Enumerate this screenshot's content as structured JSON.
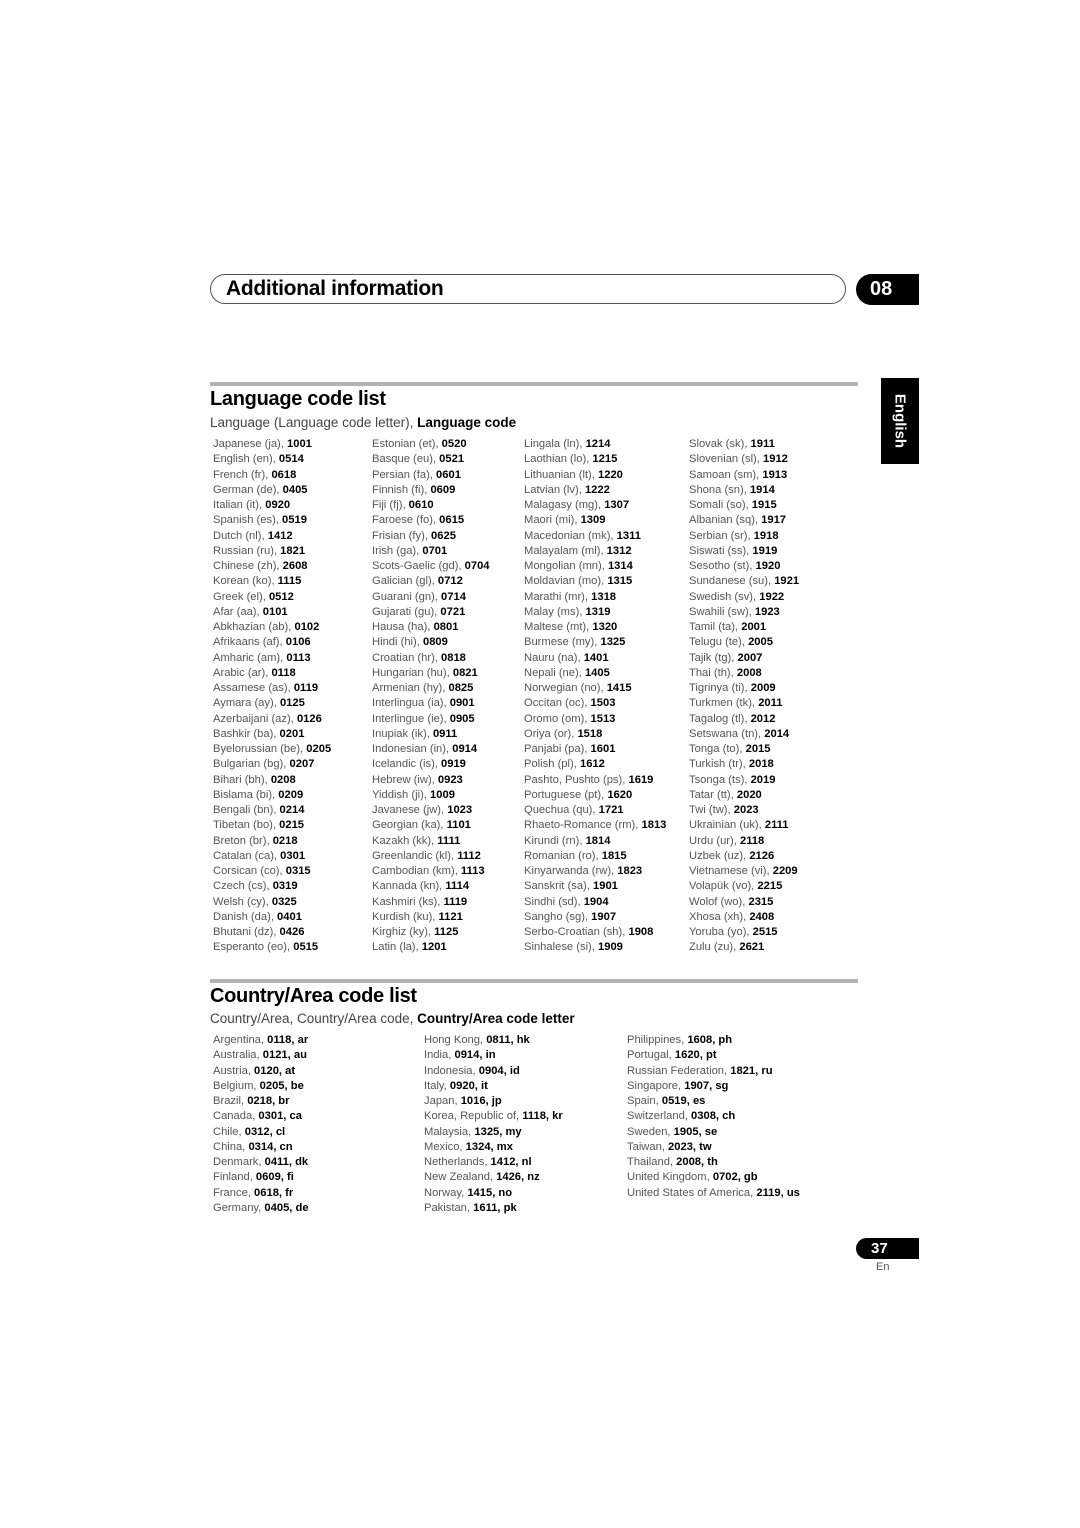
{
  "header": {
    "title": "Additional information",
    "chapter": "08",
    "language_tab": "English"
  },
  "language_section": {
    "title": "Language code list",
    "subtitle_plain": "Language (Language code letter), ",
    "subtitle_bold": "Language code",
    "columns": [
      [
        {
          "name": "Japanese (ja), ",
          "code": "1001"
        },
        {
          "name": "English (en), ",
          "code": "0514"
        },
        {
          "name": "French (fr), ",
          "code": "0618"
        },
        {
          "name": "German (de), ",
          "code": "0405"
        },
        {
          "name": "Italian (it), ",
          "code": "0920"
        },
        {
          "name": "Spanish (es), ",
          "code": "0519"
        },
        {
          "name": "Dutch (nl), ",
          "code": "1412"
        },
        {
          "name": "Russian (ru), ",
          "code": "1821"
        },
        {
          "name": "Chinese (zh), ",
          "code": "2608"
        },
        {
          "name": "Korean (ko), ",
          "code": "1115"
        },
        {
          "name": "Greek (el), ",
          "code": "0512"
        },
        {
          "name": "Afar (aa), ",
          "code": "0101"
        },
        {
          "name": "Abkhazian (ab), ",
          "code": "0102"
        },
        {
          "name": "Afrikaans (af), ",
          "code": "0106"
        },
        {
          "name": "Amharic (am), ",
          "code": "0113"
        },
        {
          "name": "Arabic (ar), ",
          "code": "0118"
        },
        {
          "name": "Assamese (as), ",
          "code": "0119"
        },
        {
          "name": "Aymara (ay), ",
          "code": "0125"
        },
        {
          "name": "Azerbaijani (az), ",
          "code": "0126"
        },
        {
          "name": "Bashkir (ba), ",
          "code": "0201"
        },
        {
          "name": "Byelorussian (be), ",
          "code": "0205"
        },
        {
          "name": "Bulgarian (bg), ",
          "code": "0207"
        },
        {
          "name": "Bihari (bh), ",
          "code": "0208"
        },
        {
          "name": "Bislama (bi), ",
          "code": "0209"
        },
        {
          "name": "Bengali (bn), ",
          "code": "0214"
        },
        {
          "name": "Tibetan (bo), ",
          "code": "0215"
        },
        {
          "name": "Breton (br), ",
          "code": "0218"
        },
        {
          "name": "Catalan (ca), ",
          "code": "0301"
        },
        {
          "name": "Corsican (co), ",
          "code": "0315"
        },
        {
          "name": "Czech (cs), ",
          "code": "0319"
        },
        {
          "name": "Welsh (cy), ",
          "code": "0325"
        },
        {
          "name": "Danish (da), ",
          "code": "0401"
        },
        {
          "name": "Bhutani (dz), ",
          "code": "0426"
        },
        {
          "name": "Esperanto (eo), ",
          "code": "0515"
        }
      ],
      [
        {
          "name": "Estonian (et), ",
          "code": "0520"
        },
        {
          "name": "Basque (eu), ",
          "code": "0521"
        },
        {
          "name": "Persian (fa), ",
          "code": "0601"
        },
        {
          "name": "Finnish (fi), ",
          "code": "0609"
        },
        {
          "name": "Fiji (fj), ",
          "code": "0610"
        },
        {
          "name": "Faroese (fo), ",
          "code": "0615"
        },
        {
          "name": "Frisian (fy), ",
          "code": "0625"
        },
        {
          "name": "Irish (ga), ",
          "code": "0701"
        },
        {
          "name": "Scots-Gaelic (gd), ",
          "code": "0704"
        },
        {
          "name": "Galician (gl), ",
          "code": "0712"
        },
        {
          "name": "Guarani (gn), ",
          "code": "0714"
        },
        {
          "name": "Gujarati (gu), ",
          "code": "0721"
        },
        {
          "name": "Hausa (ha), ",
          "code": "0801"
        },
        {
          "name": "Hindi (hi), ",
          "code": "0809"
        },
        {
          "name": "Croatian (hr), ",
          "code": "0818"
        },
        {
          "name": "Hungarian (hu), ",
          "code": "0821"
        },
        {
          "name": "Armenian (hy), ",
          "code": "0825"
        },
        {
          "name": "Interlingua (ia), ",
          "code": "0901"
        },
        {
          "name": "Interlingue (ie), ",
          "code": "0905"
        },
        {
          "name": "Inupiak (ik), ",
          "code": "0911"
        },
        {
          "name": "Indonesian (in), ",
          "code": "0914"
        },
        {
          "name": "Icelandic (is), ",
          "code": "0919"
        },
        {
          "name": "Hebrew (iw), ",
          "code": "0923"
        },
        {
          "name": "Yiddish (ji), ",
          "code": "1009"
        },
        {
          "name": "Javanese (jw), ",
          "code": "1023"
        },
        {
          "name": "Georgian (ka), ",
          "code": "1101"
        },
        {
          "name": "Kazakh (kk), ",
          "code": "1111"
        },
        {
          "name": "Greenlandic  (kl), ",
          "code": "1112"
        },
        {
          "name": "Cambodian (km), ",
          "code": "1113"
        },
        {
          "name": "Kannada (kn), ",
          "code": "1114"
        },
        {
          "name": "Kashmiri (ks), ",
          "code": "1119"
        },
        {
          "name": "Kurdish (ku), ",
          "code": "1121"
        },
        {
          "name": "Kirghiz (ky), ",
          "code": "1125"
        },
        {
          "name": "Latin (la), ",
          "code": "1201"
        }
      ],
      [
        {
          "name": "Lingala (ln), ",
          "code": "1214"
        },
        {
          "name": "Laothian (lo), ",
          "code": "1215"
        },
        {
          "name": "Lithuanian (lt), ",
          "code": "1220"
        },
        {
          "name": "Latvian (lv), ",
          "code": "1222"
        },
        {
          "name": "Malagasy (mg), ",
          "code": "1307"
        },
        {
          "name": "Maori (mi), ",
          "code": "1309"
        },
        {
          "name": "Macedonian (mk), ",
          "code": "1311"
        },
        {
          "name": "Malayalam  (ml), ",
          "code": "1312"
        },
        {
          "name": "Mongolian (mn), ",
          "code": "1314"
        },
        {
          "name": "Moldavian (mo), ",
          "code": "1315"
        },
        {
          "name": "Marathi (mr), ",
          "code": "1318"
        },
        {
          "name": "Malay  (ms), ",
          "code": "1319"
        },
        {
          "name": "Maltese (mt), ",
          "code": "1320"
        },
        {
          "name": "Burmese (my), ",
          "code": "1325"
        },
        {
          "name": "Nauru (na), ",
          "code": "1401"
        },
        {
          "name": "Nepali (ne), ",
          "code": "1405"
        },
        {
          "name": "Norwegian (no), ",
          "code": "1415"
        },
        {
          "name": "Occitan (oc), ",
          "code": "1503"
        },
        {
          "name": "Oromo (om), ",
          "code": "1513"
        },
        {
          "name": "Oriya (or), ",
          "code": "1518"
        },
        {
          "name": "Panjabi (pa), ",
          "code": "1601"
        },
        {
          "name": "Polish (pl), ",
          "code": "1612"
        },
        {
          "name": "Pashto, Pushto (ps), ",
          "code": "1619"
        },
        {
          "name": "Portuguese (pt), ",
          "code": "1620"
        },
        {
          "name": "Quechua (qu), ",
          "code": "1721"
        },
        {
          "name": "Rhaeto-Romance (rm), ",
          "code": "1813"
        },
        {
          "name": "Kirundi (rn), ",
          "code": "1814"
        },
        {
          "name": "Romanian (ro), ",
          "code": "1815"
        },
        {
          "name": "Kinyarwanda (rw), ",
          "code": "1823"
        },
        {
          "name": "Sanskrit (sa), ",
          "code": "1901"
        },
        {
          "name": "Sindhi (sd), ",
          "code": "1904"
        },
        {
          "name": "Sangho (sg), ",
          "code": "1907"
        },
        {
          "name": "Serbo-Croatian (sh), ",
          "code": "1908"
        },
        {
          "name": "Sinhalese (si), ",
          "code": "1909"
        }
      ],
      [
        {
          "name": "Slovak (sk), ",
          "code": "1911"
        },
        {
          "name": "Slovenian (sl), ",
          "code": "1912"
        },
        {
          "name": "Samoan (sm), ",
          "code": "1913"
        },
        {
          "name": "Shona (sn), ",
          "code": "1914"
        },
        {
          "name": "Somali (so), ",
          "code": "1915"
        },
        {
          "name": "Albanian (sq), ",
          "code": "1917"
        },
        {
          "name": "Serbian (sr), ",
          "code": "1918"
        },
        {
          "name": "Siswati (ss), ",
          "code": "1919"
        },
        {
          "name": "Sesotho (st), ",
          "code": "1920"
        },
        {
          "name": "Sundanese (su), ",
          "code": "1921"
        },
        {
          "name": "Swedish (sv), ",
          "code": "1922"
        },
        {
          "name": "Swahili (sw), ",
          "code": "1923"
        },
        {
          "name": "Tamil (ta), ",
          "code": "2001"
        },
        {
          "name": "Telugu (te), ",
          "code": "2005"
        },
        {
          "name": "Tajik (tg), ",
          "code": "2007"
        },
        {
          "name": "Thai (th), ",
          "code": "2008"
        },
        {
          "name": "Tigrinya (ti), ",
          "code": "2009"
        },
        {
          "name": "Turkmen (tk), ",
          "code": "2011"
        },
        {
          "name": "Tagalog (tl), ",
          "code": "2012"
        },
        {
          "name": "Setswana (tn), ",
          "code": "2014"
        },
        {
          "name": "Tonga (to), ",
          "code": "2015"
        },
        {
          "name": "Turkish (tr), ",
          "code": "2018"
        },
        {
          "name": "Tsonga (ts), ",
          "code": "2019"
        },
        {
          "name": "Tatar (tt), ",
          "code": "2020"
        },
        {
          "name": "Twi (tw), ",
          "code": "2023"
        },
        {
          "name": "Ukrainian (uk), ",
          "code": "2111"
        },
        {
          "name": "Urdu (ur), ",
          "code": "2118"
        },
        {
          "name": "Uzbek (uz), ",
          "code": "2126"
        },
        {
          "name": "Vietnamese (vi), ",
          "code": "2209"
        },
        {
          "name": "Volapük (vo), ",
          "code": "2215"
        },
        {
          "name": "Wolof (wo), ",
          "code": "2315"
        },
        {
          "name": "Xhosa (xh), ",
          "code": "2408"
        },
        {
          "name": "Yoruba (yo), ",
          "code": "2515"
        },
        {
          "name": "Zulu (zu), ",
          "code": "2621"
        }
      ]
    ]
  },
  "country_section": {
    "title": "Country/Area code list",
    "subtitle_plain": "Country/Area, Country/Area code, ",
    "subtitle_bold": "Country/Area code letter",
    "columns": [
      [
        {
          "name": "Argentina, ",
          "code": "0118, ar"
        },
        {
          "name": "Australia, ",
          "code": "0121, au"
        },
        {
          "name": "Austria, ",
          "code": "0120, at"
        },
        {
          "name": "Belgium, ",
          "code": "0205, be"
        },
        {
          "name": "Brazil, ",
          "code": "0218, br"
        },
        {
          "name": "Canada, ",
          "code": "0301, ca"
        },
        {
          "name": "Chile, ",
          "code": "0312, cl"
        },
        {
          "name": "China, ",
          "code": "0314, cn"
        },
        {
          "name": "Denmark, ",
          "code": "0411, dk"
        },
        {
          "name": "Finland, ",
          "code": "0609, fi"
        },
        {
          "name": "France, ",
          "code": "0618, fr"
        },
        {
          "name": "Germany, ",
          "code": "0405, de"
        }
      ],
      [
        {
          "name": "Hong Kong, ",
          "code": "0811, hk"
        },
        {
          "name": "India, ",
          "code": "0914, in"
        },
        {
          "name": "Indonesia, ",
          "code": "0904, id"
        },
        {
          "name": "Italy, ",
          "code": "0920, it"
        },
        {
          "name": "Japan, ",
          "code": "1016, jp"
        },
        {
          "name": "Korea, Republic of, ",
          "code": "1118, kr"
        },
        {
          "name": "Malaysia, ",
          "code": "1325, my"
        },
        {
          "name": "Mexico, ",
          "code": "1324, mx"
        },
        {
          "name": "Netherlands, ",
          "code": "1412, nl"
        },
        {
          "name": "New Zealand, ",
          "code": "1426, nz"
        },
        {
          "name": "Norway, ",
          "code": "1415, no"
        },
        {
          "name": "Pakistan, ",
          "code": "1611, pk"
        }
      ],
      [
        {
          "name": "Philippines, ",
          "code": "1608, ph"
        },
        {
          "name": "Portugal, ",
          "code": "1620, pt"
        },
        {
          "name": "Russian Federation, ",
          "code": "1821, ru"
        },
        {
          "name": "Singapore, ",
          "code": "1907, sg"
        },
        {
          "name": "Spain, ",
          "code": "0519, es"
        },
        {
          "name": "Switzerland, ",
          "code": "0308, ch"
        },
        {
          "name": "Sweden, ",
          "code": "1905, se"
        },
        {
          "name": "Taiwan, ",
          "code": "2023, tw"
        },
        {
          "name": "Thailand, ",
          "code": "2008, th"
        },
        {
          "name": "United Kingdom, ",
          "code": "0702, gb"
        },
        {
          "name": "United States of America, ",
          "code": "2119, us"
        }
      ]
    ]
  },
  "footer": {
    "page_number": "37",
    "page_language": "En"
  }
}
